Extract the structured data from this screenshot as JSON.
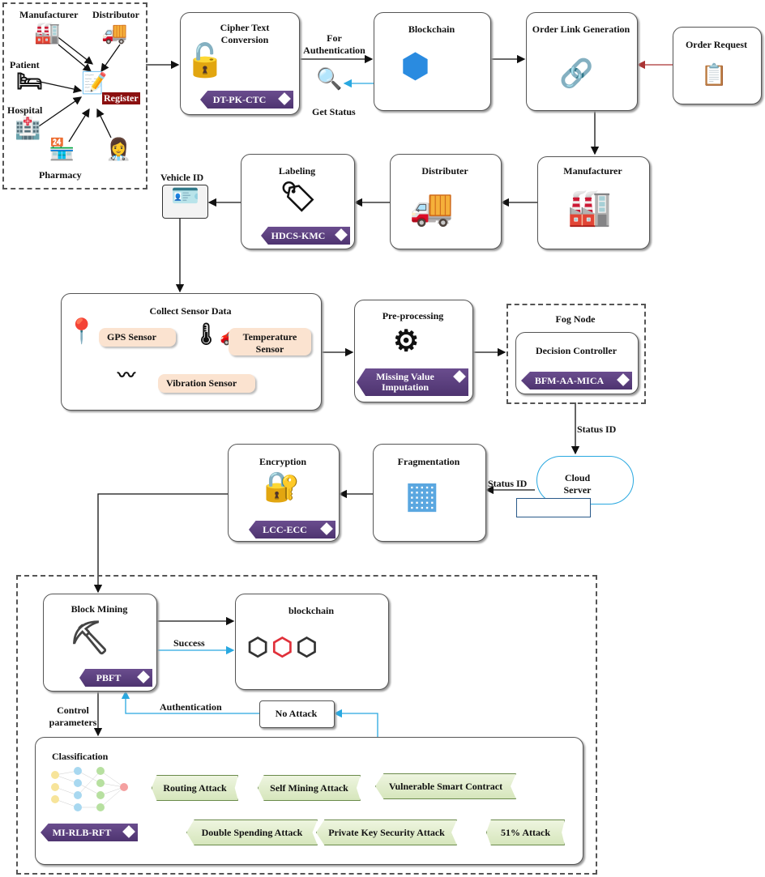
{
  "registration": {
    "manufacturer": "Manufacturer",
    "distributor": "Distributor",
    "patient": "Patient",
    "hospital": "Hospital",
    "pharmacy": "Pharmacy",
    "register": "Register"
  },
  "cipher": {
    "title": "Cipher Text Conversion",
    "badge": "DT-PK-CTC"
  },
  "for_auth": "For Authentication",
  "get_status": "Get Status",
  "blockchain_top": {
    "title": "Blockchain"
  },
  "order_link": {
    "title": "Order Link Generation"
  },
  "order_request": {
    "title": "Order Request"
  },
  "manufacturer": {
    "title": "Manufacturer"
  },
  "distributer": {
    "title": "Distributer"
  },
  "labeling": {
    "title": "Labeling",
    "badge": "HDCS-KMC"
  },
  "vehicle_id": "Vehicle ID",
  "sensors": {
    "title": "Collect Sensor Data",
    "gps": "GPS Sensor",
    "temperature": "Temperature Sensor",
    "vibration": "Vibration Sensor"
  },
  "preprocessing": {
    "title": "Pre-processing",
    "badge": "Missing Value Imputation"
  },
  "fog": {
    "title": "Fog Node",
    "controller": "Decision Controller",
    "badge": "BFM-AA-MICA"
  },
  "status_id_1": "Status ID",
  "status_id_2": "Status ID",
  "cloud": {
    "title": "Cloud Server"
  },
  "fragmentation": {
    "title": "Fragmentation"
  },
  "encryption": {
    "title": "Encryption",
    "badge": "LCC-ECC"
  },
  "mining": {
    "title": "Block Mining",
    "badge": "PBFT"
  },
  "success": "Success",
  "blockchain_bottom": {
    "title": "blockchain"
  },
  "authentication": "Authentication",
  "no_attack": "No Attack",
  "control": "Control parameters",
  "classification": {
    "title": "Classification",
    "badge": "MI-RLB-RFT",
    "attacks": [
      "Routing Attack",
      "Self Mining Attack",
      "Vulnerable Smart Contract",
      "Double Spending Attack",
      "Private Key Security Attack",
      "51% Attack"
    ]
  }
}
